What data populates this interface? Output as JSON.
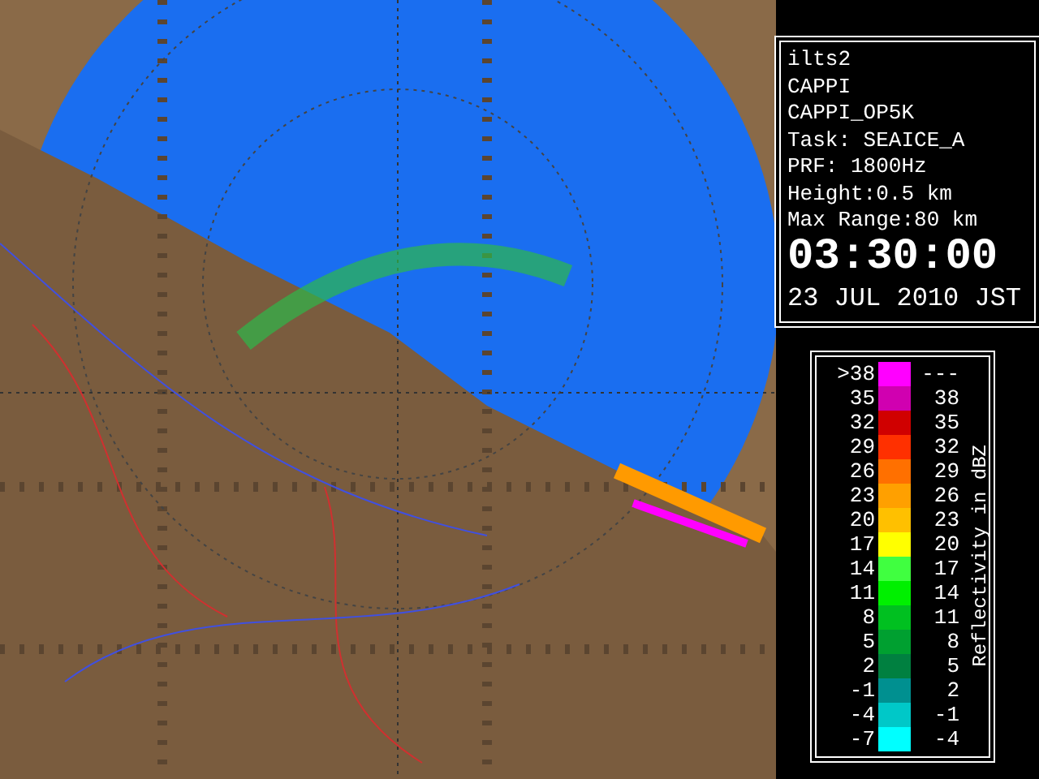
{
  "info": {
    "lines": [
      "ilts2",
      "CAPPI",
      "CAPPI_OP5K",
      "Task: SEAICE_A",
      "PRF: 1800Hz",
      "Height:0.5 km",
      "Max Range:80 km"
    ],
    "time": "03:30:00",
    "date": "23 JUL 2010 JST"
  },
  "legend": {
    "title": "Reflectivity in dBZ",
    "rows": [
      {
        "low": ">38",
        "high": "---",
        "color": "#ff00ff"
      },
      {
        "low": "35",
        "high": "38",
        "color": "#d000b0"
      },
      {
        "low": "32",
        "high": "35",
        "color": "#d00000"
      },
      {
        "low": "29",
        "high": "32",
        "color": "#ff3000"
      },
      {
        "low": "26",
        "high": "29",
        "color": "#ff7000"
      },
      {
        "low": "23",
        "high": "26",
        "color": "#ffa000"
      },
      {
        "low": "20",
        "high": "23",
        "color": "#ffc000"
      },
      {
        "low": "17",
        "high": "20",
        "color": "#ffff00"
      },
      {
        "low": "14",
        "high": "17",
        "color": "#40ff40"
      },
      {
        "low": "11",
        "high": "14",
        "color": "#00f000"
      },
      {
        "low": "8",
        "high": "11",
        "color": "#00c020"
      },
      {
        "low": "5",
        "high": "8",
        "color": "#00a030"
      },
      {
        "low": "2",
        "high": "5",
        "color": "#008040"
      },
      {
        "low": "-1",
        "high": "2",
        "color": "#009090"
      },
      {
        "low": "-4",
        "high": "-1",
        "color": "#00c8c8"
      },
      {
        "low": "-7",
        "high": "-4",
        "color": "#00ffff"
      }
    ]
  }
}
